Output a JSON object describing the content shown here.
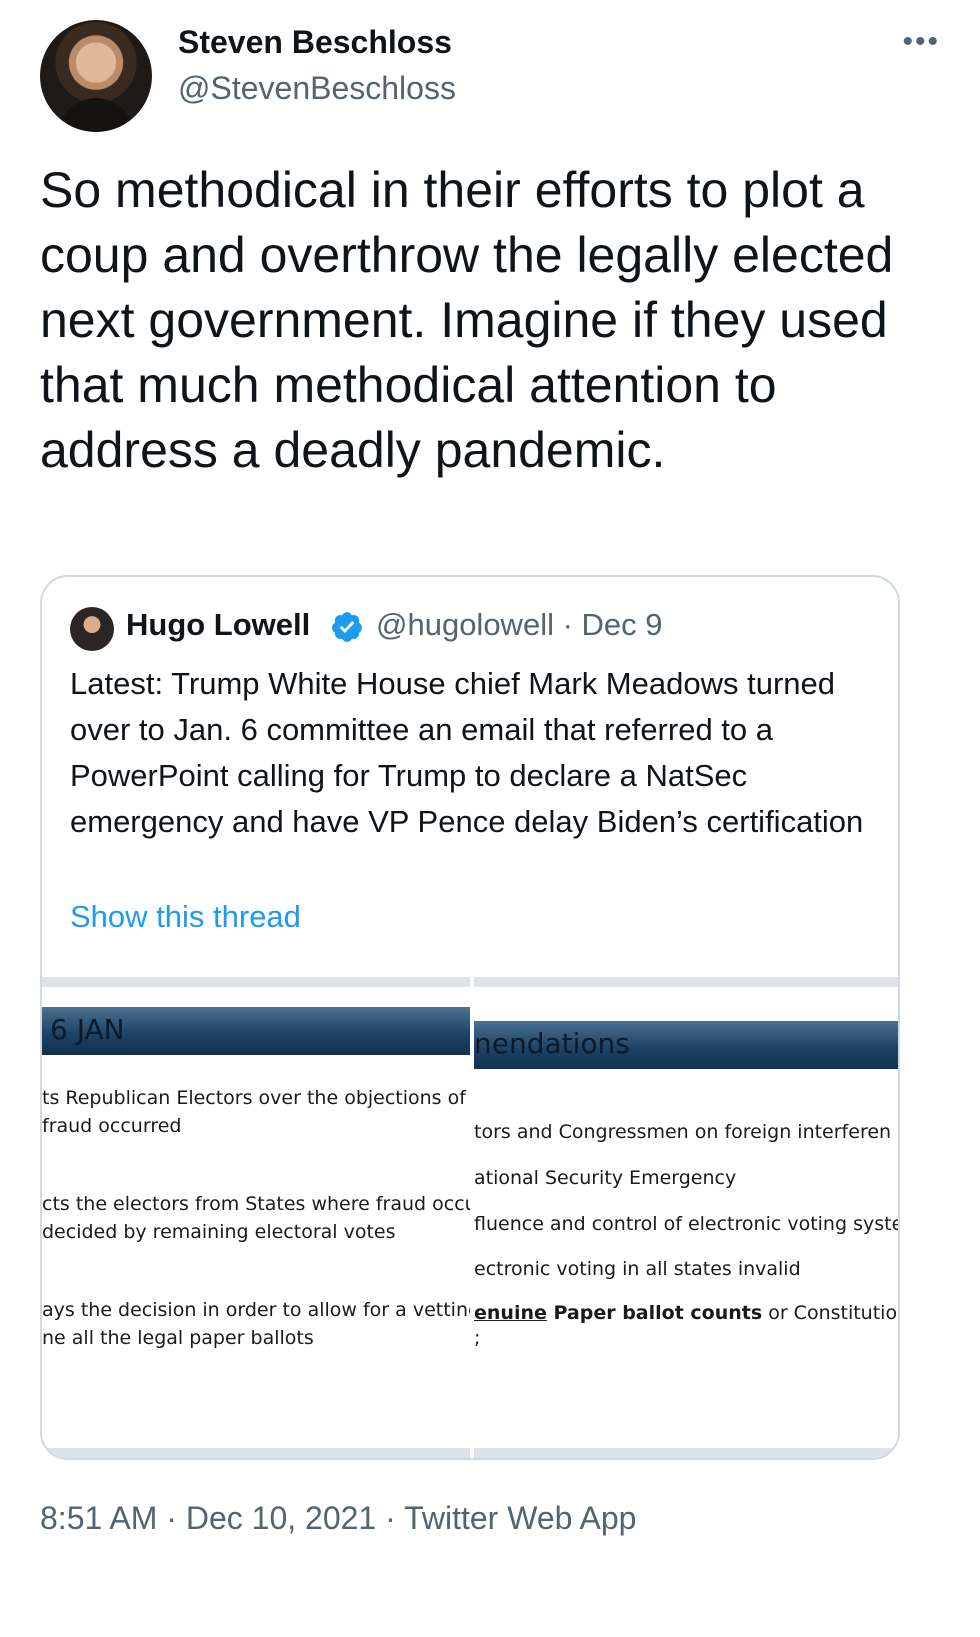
{
  "author": {
    "display_name": "Steven Beschloss",
    "handle": "@StevenBeschloss",
    "avatar_icon": "profile-photo",
    "more_icon": "•••"
  },
  "tweet": {
    "text": "So methodical in their efforts to plot a coup and overthrow the legally elected next government. Imagine if they used that much methodical attention to address a deadly pandemic."
  },
  "quote": {
    "display_name": "Hugo Lowell",
    "verified_icon": "verified-badge-icon",
    "handle_date": "@hugolowell · Dec 9",
    "text": "Latest: Trump White House chief Mark Meadows turned over to Jan. 6 committee an email that referred to a PowerPoint calling for Trump to declare a NatSec emergency and have VP Pence delay Biden’s certification",
    "show_thread": "Show this thread",
    "accent_color": "#1d9bf0"
  },
  "slides": {
    "left": {
      "title": "6 JAN",
      "lines": [
        "ts Republican Electors over the objections of D",
        "fraud occurred",
        "cts the electors from States where fraud occu",
        " decided by remaining electoral votes",
        "ays the decision in order to allow for a vetting",
        "ne all the legal paper ballots"
      ]
    },
    "right": {
      "title": "nendations",
      "lines": [
        "tors and Congressmen on foreign interferen",
        "ational Security Emergency",
        "fluence and control of electronic voting syste",
        "ectronic voting in all states invalid",
        "enuine",
        " Paper ballot counts",
        " or Constitutional rem",
        ";"
      ]
    }
  },
  "meta": {
    "timestamp": "8:51 AM · Dec 10, 2021 · Twitter Web App"
  }
}
